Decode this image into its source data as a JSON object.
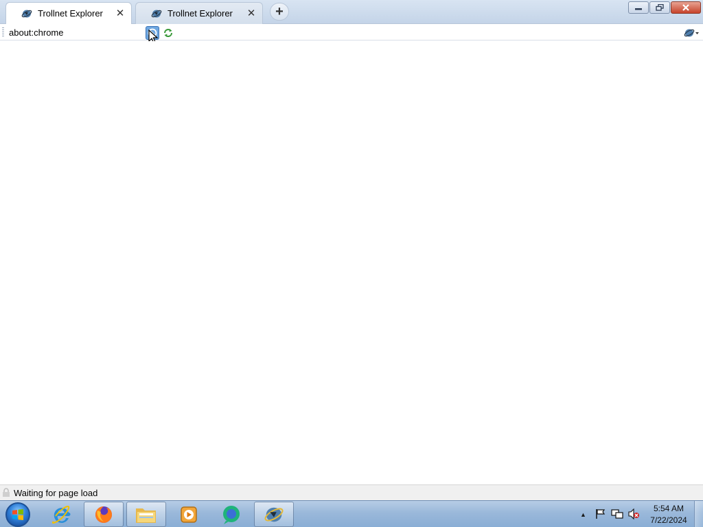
{
  "tabs": [
    {
      "title": "Trollnet Explorer",
      "close": "✕",
      "active": true
    },
    {
      "title": "Trollnet Explorer",
      "close": "✕",
      "active": false
    }
  ],
  "new_tab_label": "+",
  "window_controls": {
    "minimize_icon": "minimize-icon",
    "restore_icon": "restore-icon",
    "close_icon": "close-icon"
  },
  "address_bar": {
    "url": "about:chrome"
  },
  "nav": {
    "stop_icon": "stop-icon",
    "refresh_icon": "refresh-icon",
    "menu_icon": "browser-menu-icon"
  },
  "status_bar": {
    "text": "Waiting for page load"
  },
  "taskbar": {
    "pinned": [
      {
        "name": "internet-explorer",
        "icon": "ie-icon"
      },
      {
        "name": "firefox",
        "icon": "firefox-icon"
      },
      {
        "name": "file-explorer",
        "icon": "folder-icon"
      },
      {
        "name": "media-player",
        "icon": "media-player-icon"
      },
      {
        "name": "chat-app",
        "icon": "chat-icon"
      },
      {
        "name": "trollnet-explorer",
        "icon": "trollnet-icon"
      }
    ],
    "clock": {
      "time": "5:54 AM",
      "date": "7/22/2024"
    }
  },
  "colors": {
    "accent": "#3b74b8",
    "taskbar": "#9ab8da",
    "close_button": "#c7432b"
  }
}
